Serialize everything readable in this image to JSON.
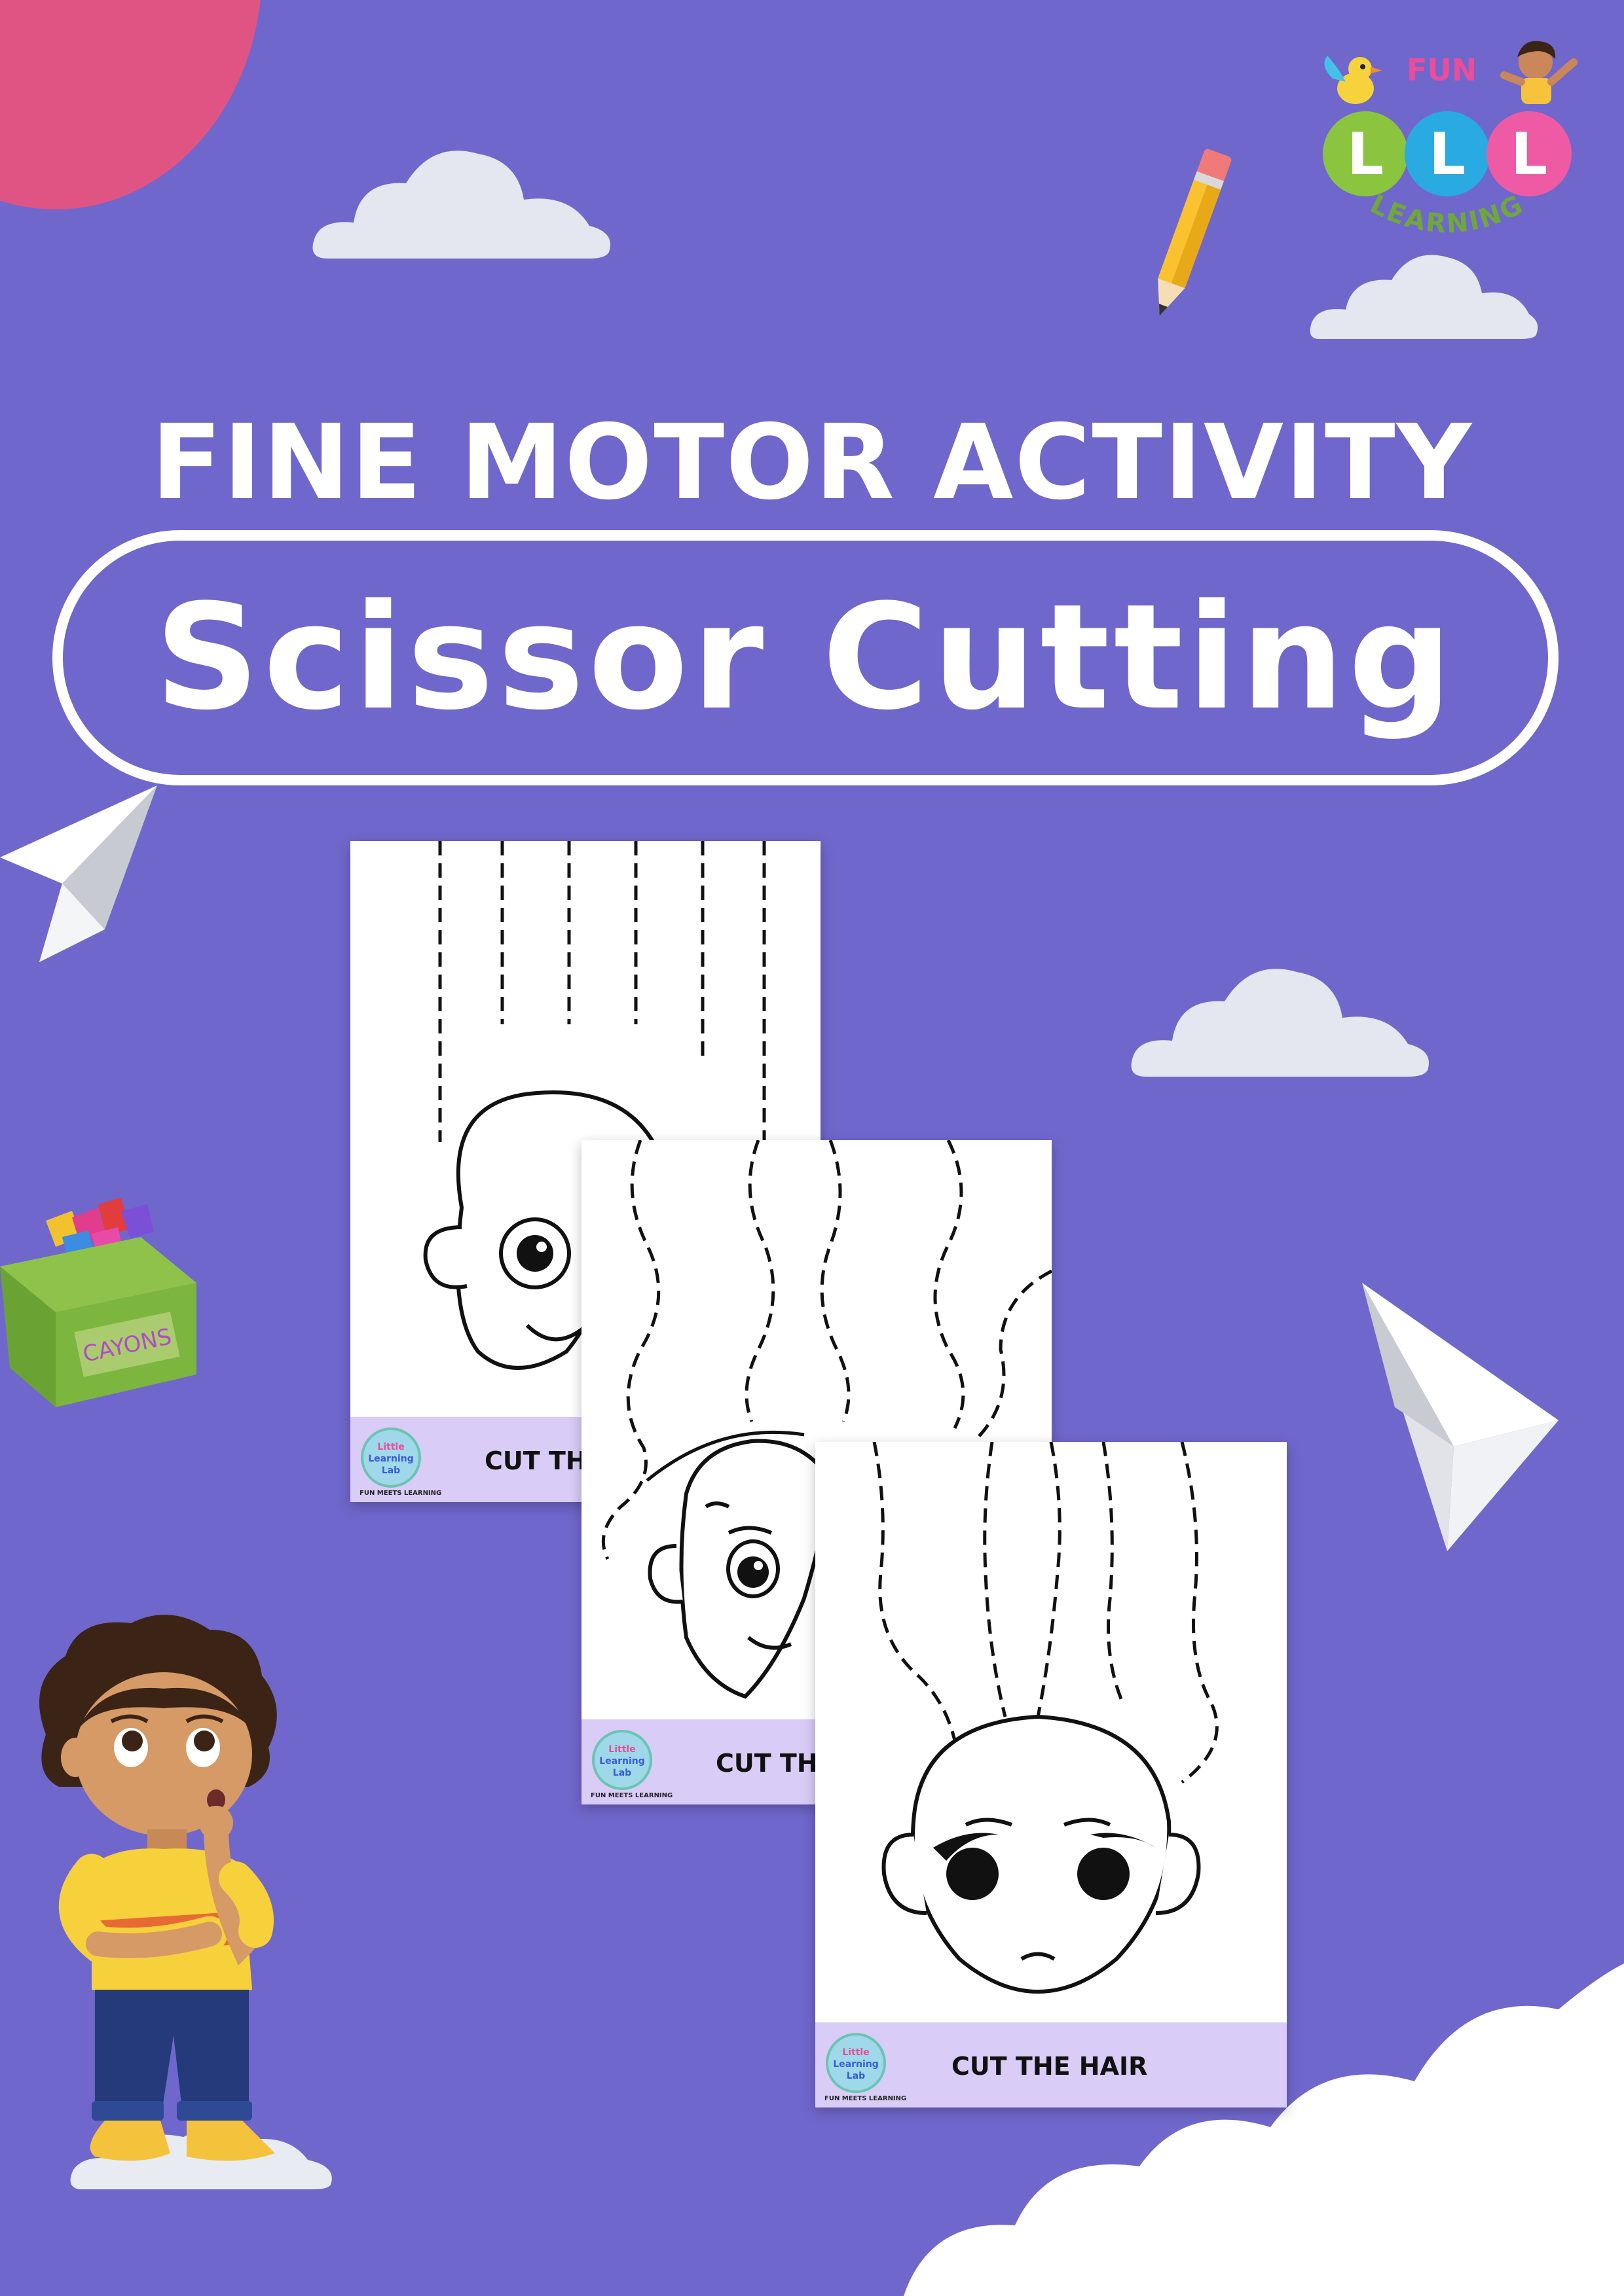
{
  "header": {
    "headline": "FINE MOTOR ACTIVITY",
    "title": "Scissor Cutting"
  },
  "brand": {
    "fun": "FUN",
    "letters": [
      "L",
      "L",
      "L"
    ],
    "learning": "LEARNING",
    "letter_colors": [
      "#8bc53f",
      "#29abe2",
      "#ee5ba4"
    ]
  },
  "decor": {
    "crayon_box_label": "CAYONS",
    "icons": [
      "pencil-icon",
      "paper-plane-icon",
      "crayon-box-icon",
      "cloud-icon",
      "boy-thinking-illustration"
    ]
  },
  "worksheets": [
    {
      "footer_label": "CUT TH",
      "logo_lines": [
        "Little",
        "Learning",
        "Lab"
      ],
      "tagline": "FUN MEETS LEARNING"
    },
    {
      "footer_label": "CUT TH",
      "logo_lines": [
        "Little",
        "Learning",
        "Lab"
      ],
      "tagline": "FUN MEETS LEARNING"
    },
    {
      "footer_label": "CUT THE HAIR",
      "logo_lines": [
        "Little",
        "Learning",
        "Lab"
      ],
      "tagline": "FUN MEETS LEARNING"
    }
  ],
  "colors": {
    "background": "#7067cc",
    "accent_pink": "#e05484",
    "footer_lavender": "#d9ccf7",
    "cloud": "#e4e7ef"
  }
}
